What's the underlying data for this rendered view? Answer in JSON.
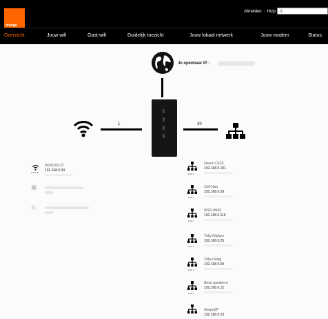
{
  "header": {
    "logo_text": "orange",
    "links": [
      "Afmelden",
      "Hulp"
    ],
    "search_icon": "search-icon"
  },
  "nav": {
    "items": [
      {
        "label": "Overzicht",
        "active": true
      },
      {
        "label": "Jouw wifi",
        "active": false
      },
      {
        "label": "Gast-wifi",
        "active": false
      },
      {
        "label": "Duidelijk toezicht",
        "active": false
      },
      {
        "label": "Jouw lokaal netwerk",
        "active": false
      },
      {
        "label": "Jouw modem",
        "active": false
      },
      {
        "label": "Status",
        "active": false
      }
    ],
    "active_color": "#ff6600"
  },
  "diagram": {
    "ip_label": "Je openbaar IP :",
    "wifi_count": "1",
    "lan_count": "30"
  },
  "wifi_panel": {
    "ssid": "W20193173",
    "ip": "192.168.0.34",
    "band_label": "2.4 GHz"
  },
  "lan_devices": [
    {
      "name": "Denon CEOL",
      "ip": "192.168.0.101"
    },
    {
      "name": "Cell-Vaio",
      "ip": "192.168.0.59"
    },
    {
      "name": "WSD-B665",
      "ip": "192.168.0.116"
    },
    {
      "name": "Triby Kitchen",
      "ip": "192.168.0.25"
    },
    {
      "name": "Triby Living",
      "ip": "192.168.0.69"
    },
    {
      "name": "Bose speaker-o",
      "ip": "192.168.0.12"
    },
    {
      "name": "NoripoZP",
      "ip": "192.168.0.23"
    }
  ],
  "lan_tag": "LAN 1"
}
